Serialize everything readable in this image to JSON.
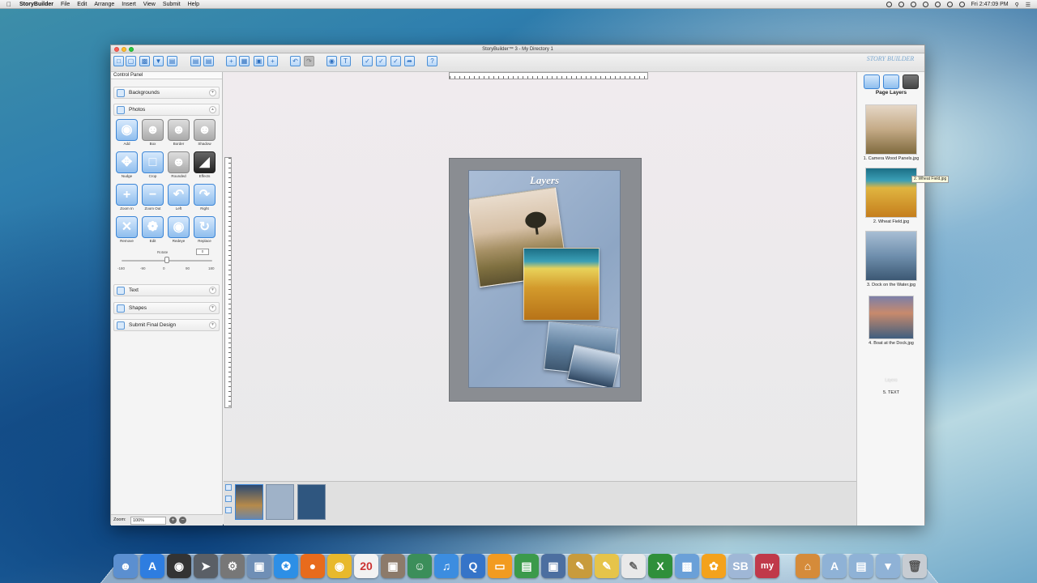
{
  "menubar": {
    "app_name": "StoryBuilder",
    "items": [
      "File",
      "Edit",
      "Arrange",
      "Insert",
      "View",
      "Submit",
      "Help"
    ],
    "clock": "Fri 2:47:09 PM"
  },
  "window": {
    "title": "StoryBuilder™ 3 - My Directory 1"
  },
  "control_panel": {
    "title": "Control Panel",
    "sections": {
      "backgrounds": "Backgrounds",
      "photos": "Photos",
      "text": "Text",
      "shapes": "Shapes",
      "submit": "Submit Final Design"
    },
    "tools": [
      {
        "label": "Add",
        "icon": "camera-icon"
      },
      {
        "label": "Box",
        "icon": "person-box-icon"
      },
      {
        "label": "Border",
        "icon": "person-border-icon"
      },
      {
        "label": "Shadow",
        "icon": "person-shadow-icon"
      },
      {
        "label": "Nudge",
        "icon": "nudge-icon"
      },
      {
        "label": "Crop",
        "icon": "crop-icon"
      },
      {
        "label": "Rounded",
        "icon": "person-rounded-icon"
      },
      {
        "label": "Effects",
        "icon": "effects-icon"
      },
      {
        "label": "Zoom In",
        "icon": "plus-icon"
      },
      {
        "label": "Zoom Out",
        "icon": "minus-icon"
      },
      {
        "label": "Left",
        "icon": "rotate-left-icon"
      },
      {
        "label": "Right",
        "icon": "rotate-right-icon"
      },
      {
        "label": "Remove",
        "icon": "x-icon"
      },
      {
        "label": "Edit",
        "icon": "edit-icon"
      },
      {
        "label": "Redeye",
        "icon": "eye-icon"
      },
      {
        "label": "Replace",
        "icon": "replace-icon"
      }
    ],
    "rotate": {
      "label": "Rotate",
      "value": "0",
      "ticks": [
        "-180",
        "-90",
        "0",
        "90",
        "180"
      ],
      "level": 0.5
    },
    "zoom": {
      "label": "Zoom:",
      "value": "100%"
    }
  },
  "canvas": {
    "page_title": "Layers"
  },
  "layers_panel": {
    "title": "Page Layers",
    "layers": [
      "1. Camera Wood Panels.jpg",
      "2. Wheat Field.jpg",
      "3. Dock on the Water.jpg",
      "4. Boat at the Dock.jpg",
      "5. TEXT"
    ],
    "text_layer_preview": "Layers",
    "tooltip": "2. Wheat Field.jpg",
    "brand": "STORY BUILDER"
  },
  "colors": {
    "accent": "#3d86d6",
    "canvas_bg": "#eeeaec",
    "page_bg": "#8a8d92"
  }
}
